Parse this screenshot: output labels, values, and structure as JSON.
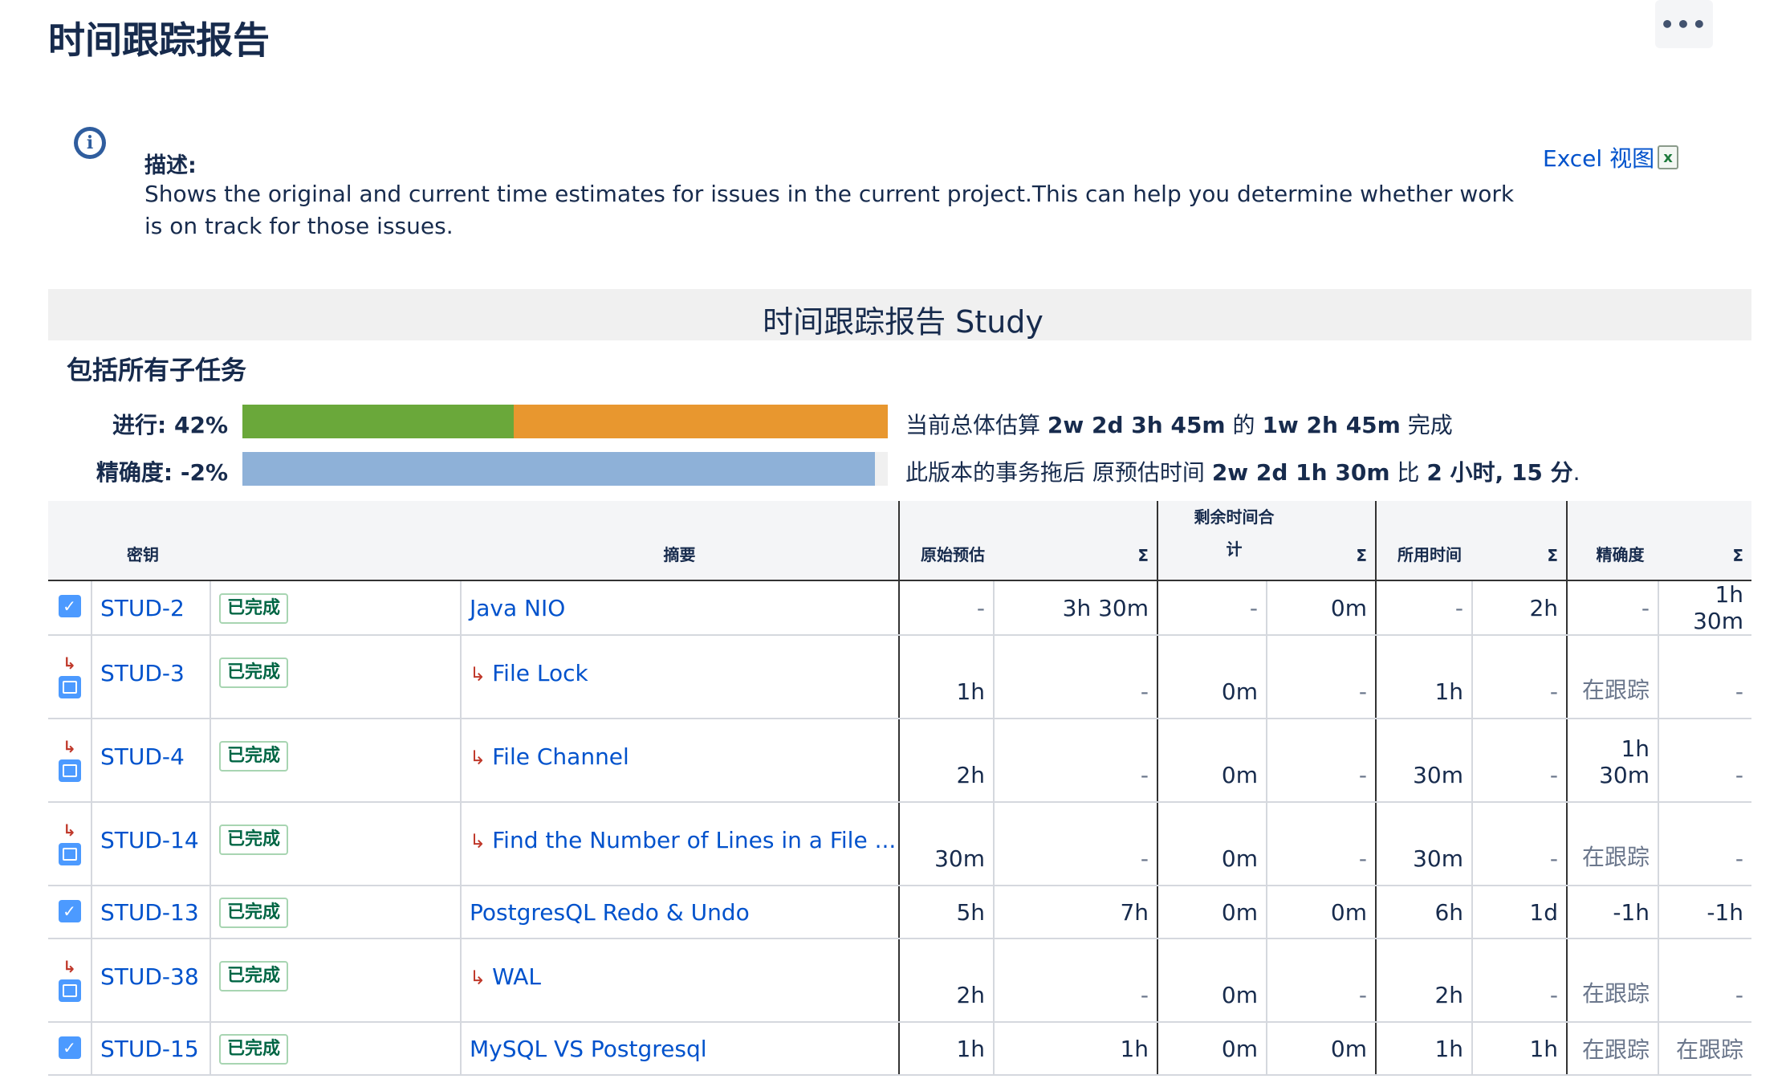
{
  "page": {
    "title": "时间跟踪报告",
    "more_label": "•••"
  },
  "description": {
    "label": "描述:",
    "text": "Shows the original and current time estimates for issues in the current project.This can help you determine whether work is on track for those issues.",
    "excel_label": "Excel 视图",
    "excel_icon": "x"
  },
  "report": {
    "title": "时间跟踪报告 Study",
    "subtasks_label": "包括所有子任务",
    "progress": {
      "label": "进行: 42%",
      "value_percent": 42,
      "text_prefix": "当前总体估算",
      "estimate": "2w 2d 3h 45m",
      "text_mid": "的",
      "done": "1w 2h 45m",
      "text_suffix": "完成"
    },
    "accuracy": {
      "label": "精确度: -2%",
      "value_percent": -2,
      "text_prefix": "此版本的事务拖后 原预估时间",
      "original": "2w 2d 1h 30m",
      "text_mid": "比",
      "behind": "2 小时, 15 分",
      "text_suffix": "."
    }
  },
  "table": {
    "headers": {
      "key": "密钥",
      "summary": "摘要",
      "original": "原始预估",
      "remaining": "剩余时间合计",
      "remaining_line1": "剩余时间合",
      "remaining_line2": "计",
      "spent": "所用时间",
      "accuracy": "精确度",
      "sigma": "Σ"
    },
    "rows": [
      {
        "type": "task",
        "key": "STUD-2",
        "status": "已完成",
        "summary": "Java NIO",
        "orig": "-",
        "orig_sum": "3h 30m",
        "rem": "-",
        "rem_sum": "0m",
        "spent": "-",
        "spent_sum": "2h",
        "acc": "-",
        "acc_sum": "1h 30m"
      },
      {
        "type": "subtask",
        "key": "STUD-3",
        "status": "已完成",
        "summary": "File Lock",
        "orig": "1h",
        "orig_sum": "-",
        "rem": "0m",
        "rem_sum": "-",
        "spent": "1h",
        "spent_sum": "-",
        "acc": "在跟踪",
        "acc_sum": "-"
      },
      {
        "type": "subtask",
        "key": "STUD-4",
        "status": "已完成",
        "summary": "File Channel",
        "orig": "2h",
        "orig_sum": "-",
        "rem": "0m",
        "rem_sum": "-",
        "spent": "30m",
        "spent_sum": "-",
        "acc": "1h 30m",
        "acc_sum": "-"
      },
      {
        "type": "subtask",
        "key": "STUD-14",
        "status": "已完成",
        "summary": "Find the Number of Lines in a File ...",
        "orig": "30m",
        "orig_sum": "-",
        "rem": "0m",
        "rem_sum": "-",
        "spent": "30m",
        "spent_sum": "-",
        "acc": "在跟踪",
        "acc_sum": "-"
      },
      {
        "type": "task",
        "key": "STUD-13",
        "status": "已完成",
        "summary": "PostgresQL Redo & Undo",
        "orig": "5h",
        "orig_sum": "7h",
        "rem": "0m",
        "rem_sum": "0m",
        "spent": "6h",
        "spent_sum": "1d",
        "acc": "-1h",
        "acc_sum": "-1h"
      },
      {
        "type": "subtask",
        "key": "STUD-38",
        "status": "已完成",
        "summary": "WAL",
        "orig": "2h",
        "orig_sum": "-",
        "rem": "0m",
        "rem_sum": "-",
        "spent": "2h",
        "spent_sum": "-",
        "acc": "在跟踪",
        "acc_sum": "-"
      },
      {
        "type": "task",
        "key": "STUD-15",
        "status": "已完成",
        "summary": "MySQL VS Postgresql",
        "orig": "1h",
        "orig_sum": "1h",
        "rem": "0m",
        "rem_sum": "0m",
        "spent": "1h",
        "spent_sum": "1h",
        "acc": "在跟踪",
        "acc_sum": "在跟踪"
      }
    ]
  },
  "colors": {
    "progress_done": "#6aa83a",
    "progress_remaining": "#e8972f",
    "accuracy_bar": "#8eb1d8",
    "link": "#0052cc"
  }
}
